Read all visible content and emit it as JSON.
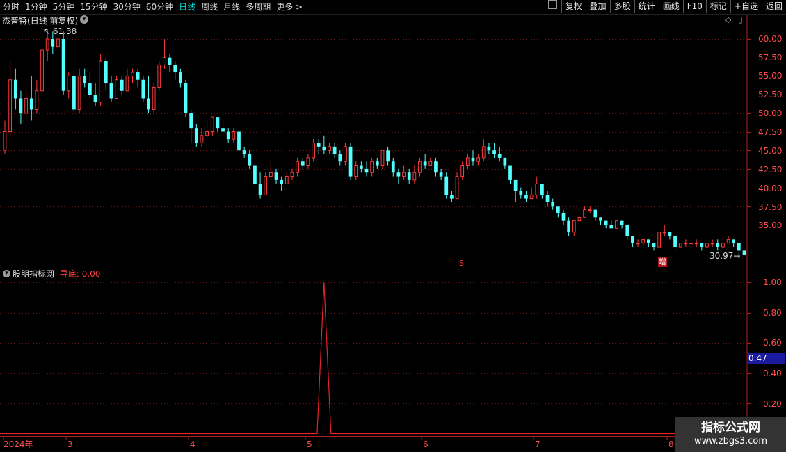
{
  "toolbar": {
    "periods": [
      "分时",
      "1分钟",
      "5分钟",
      "15分钟",
      "30分钟",
      "60分钟",
      "日线",
      "周线",
      "月线",
      "多周期",
      "更多 >"
    ],
    "active_period": "日线",
    "right_buttons": [
      "复权",
      "叠加",
      "多股",
      "统计",
      "画线",
      "F10",
      "标记",
      "+自选",
      "返回"
    ]
  },
  "main_chart": {
    "stock_name": "杰普特",
    "chart_desc": "(日线 前复权)",
    "high_label": "61.38",
    "low_label": "30.97",
    "marker_s": "S",
    "marker_zeng": "增",
    "y_ticks": [
      "60.00",
      "57.50",
      "55.00",
      "52.50",
      "50.00",
      "47.50",
      "45.00",
      "42.50",
      "40.00",
      "37.50",
      "35.00"
    ],
    "colors": {
      "up": "#ff3c3c",
      "down": "#54ffff",
      "grid": "#7a1414"
    }
  },
  "indicator": {
    "name": "股朋指标网",
    "line_label": "寻底:",
    "line_value": "0.00",
    "y_ticks": [
      "1.00",
      "0.80",
      "0.60",
      "0.40",
      "0.20"
    ],
    "current_value": "0.47"
  },
  "x_axis": {
    "labels": [
      "2024年",
      "3",
      "4",
      "5",
      "6",
      "7",
      "8"
    ]
  },
  "watermark": {
    "line1": "指标公式网",
    "line2": "www.zbgs3.com"
  },
  "chart_data": {
    "type": "candlestick",
    "title": "杰普特 (日线 前复权)",
    "ylim": [
      31,
      62
    ],
    "candles": [
      [
        45.0,
        47.5,
        44.5,
        49.0
      ],
      [
        47.5,
        54.5,
        47.0,
        57.0
      ],
      [
        54.5,
        52.0,
        50.5,
        56.0
      ],
      [
        52.0,
        50.0,
        48.5,
        53.0
      ],
      [
        50.0,
        52.0,
        49.0,
        54.0
      ],
      [
        52.0,
        50.5,
        49.0,
        55.0
      ],
      [
        50.5,
        53.0,
        50.0,
        54.5
      ],
      [
        53.0,
        58.5,
        52.5,
        59.0
      ],
      [
        58.5,
        60.0,
        57.0,
        61.38
      ],
      [
        60.0,
        59.0,
        58.0,
        61.0
      ],
      [
        59.0,
        60.0,
        58.5,
        60.5
      ],
      [
        60.0,
        53.0,
        52.5,
        61.0
      ],
      [
        53.0,
        55.0,
        52.0,
        55.5
      ],
      [
        55.0,
        50.5,
        50.0,
        55.5
      ],
      [
        50.5,
        55.0,
        50.0,
        56.0
      ],
      [
        55.0,
        54.0,
        53.5,
        56.0
      ],
      [
        54.0,
        52.5,
        52.0,
        55.5
      ],
      [
        52.5,
        51.5,
        51.0,
        54.0
      ],
      [
        51.5,
        57.0,
        51.0,
        58.0
      ],
      [
        57.0,
        54.0,
        53.0,
        57.5
      ],
      [
        54.0,
        52.0,
        51.5,
        55.0
      ],
      [
        52.0,
        54.5,
        52.0,
        55.0
      ],
      [
        54.5,
        53.0,
        52.5,
        55.0
      ],
      [
        53.0,
        55.0,
        53.0,
        56.0
      ],
      [
        55.0,
        55.5,
        54.0,
        56.0
      ],
      [
        55.5,
        54.5,
        53.5,
        56.0
      ],
      [
        54.5,
        52.0,
        51.5,
        55.0
      ],
      [
        52.0,
        50.5,
        50.0,
        55.0
      ],
      [
        50.5,
        53.5,
        50.0,
        54.0
      ],
      [
        53.5,
        56.5,
        53.0,
        57.0
      ],
      [
        56.5,
        57.5,
        56.0,
        60.0
      ],
      [
        57.5,
        56.5,
        55.5,
        58.0
      ],
      [
        56.5,
        55.5,
        54.5,
        57.0
      ],
      [
        55.5,
        54.0,
        53.5,
        56.0
      ],
      [
        54.0,
        50.0,
        49.5,
        54.5
      ],
      [
        50.0,
        48.0,
        46.0,
        50.5
      ],
      [
        48.0,
        46.0,
        45.5,
        48.5
      ],
      [
        46.0,
        47.0,
        45.5,
        48.0
      ],
      [
        47.0,
        47.5,
        46.5,
        49.0
      ],
      [
        47.5,
        49.5,
        47.0,
        49.5
      ],
      [
        49.5,
        48.0,
        47.5,
        49.5
      ],
      [
        48.0,
        47.5,
        47.0,
        49.0
      ],
      [
        47.5,
        46.5,
        46.0,
        48.0
      ],
      [
        46.5,
        47.5,
        46.0,
        48.0
      ],
      [
        47.5,
        45.0,
        44.5,
        48.0
      ],
      [
        45.0,
        44.5,
        44.0,
        45.5
      ],
      [
        44.5,
        43.0,
        42.5,
        45.0
      ],
      [
        43.0,
        40.5,
        40.0,
        43.5
      ],
      [
        40.5,
        39.0,
        38.5,
        42.0
      ],
      [
        39.0,
        41.5,
        39.0,
        42.0
      ],
      [
        41.5,
        42.0,
        41.0,
        43.5
      ],
      [
        42.0,
        41.0,
        40.5,
        42.5
      ],
      [
        41.0,
        40.5,
        39.5,
        41.5
      ],
      [
        40.5,
        41.5,
        40.5,
        42.0
      ],
      [
        41.5,
        42.0,
        41.0,
        42.5
      ],
      [
        42.0,
        43.5,
        41.5,
        44.0
      ],
      [
        43.5,
        43.0,
        42.5,
        44.0
      ],
      [
        43.0,
        44.0,
        42.5,
        44.5
      ],
      [
        44.0,
        46.0,
        43.5,
        46.5
      ],
      [
        46.0,
        45.5,
        44.5,
        46.5
      ],
      [
        45.5,
        45.0,
        44.5,
        47.0
      ],
      [
        45.0,
        45.5,
        44.5,
        46.0
      ],
      [
        45.5,
        44.5,
        44.0,
        46.0
      ],
      [
        44.5,
        43.5,
        43.0,
        45.0
      ],
      [
        43.5,
        45.5,
        43.0,
        46.0
      ],
      [
        45.5,
        41.5,
        41.0,
        46.0
      ],
      [
        41.5,
        43.0,
        41.0,
        43.5
      ],
      [
        43.0,
        42.5,
        42.0,
        43.5
      ],
      [
        42.5,
        42.0,
        41.5,
        43.5
      ],
      [
        42.0,
        43.5,
        41.5,
        44.0
      ],
      [
        43.5,
        43.0,
        42.5,
        44.0
      ],
      [
        43.0,
        45.0,
        42.5,
        45.0
      ],
      [
        45.0,
        43.5,
        43.0,
        45.5
      ],
      [
        43.5,
        42.0,
        41.5,
        44.0
      ],
      [
        42.0,
        41.5,
        40.5,
        42.5
      ],
      [
        41.5,
        42.0,
        41.0,
        43.0
      ],
      [
        42.0,
        41.0,
        40.5,
        42.5
      ],
      [
        41.0,
        42.0,
        40.5,
        43.0
      ],
      [
        42.0,
        43.5,
        41.5,
        44.0
      ],
      [
        43.5,
        43.0,
        42.5,
        44.5
      ],
      [
        43.0,
        43.5,
        43.0,
        44.0
      ],
      [
        43.5,
        42.0,
        41.5,
        44.0
      ],
      [
        42.0,
        41.5,
        41.0,
        42.5
      ],
      [
        41.5,
        39.0,
        38.5,
        42.0
      ],
      [
        39.0,
        38.5,
        38.0,
        39.5
      ],
      [
        38.5,
        41.5,
        38.5,
        42.0
      ],
      [
        41.5,
        43.0,
        41.0,
        43.5
      ],
      [
        43.0,
        44.0,
        42.5,
        44.5
      ],
      [
        44.0,
        43.5,
        43.0,
        45.0
      ],
      [
        43.5,
        44.0,
        43.0,
        44.5
      ],
      [
        44.0,
        45.5,
        43.5,
        46.5
      ],
      [
        45.5,
        45.0,
        44.5,
        46.0
      ],
      [
        45.0,
        44.5,
        44.0,
        46.0
      ],
      [
        44.5,
        44.0,
        43.5,
        45.5
      ],
      [
        44.0,
        43.0,
        42.5,
        44.0
      ],
      [
        43.0,
        41.0,
        40.5,
        43.0
      ],
      [
        41.0,
        39.5,
        38.0,
        41.0
      ],
      [
        39.5,
        39.0,
        38.5,
        40.0
      ],
      [
        39.0,
        38.5,
        38.0,
        39.5
      ],
      [
        38.5,
        39.0,
        38.5,
        40.0
      ],
      [
        39.0,
        40.5,
        38.5,
        41.5
      ],
      [
        40.5,
        39.0,
        38.5,
        40.5
      ],
      [
        39.0,
        38.0,
        37.5,
        39.5
      ],
      [
        38.0,
        37.5,
        37.0,
        38.5
      ],
      [
        37.5,
        36.5,
        36.0,
        37.5
      ],
      [
        36.5,
        35.5,
        35.0,
        37.0
      ],
      [
        35.5,
        34.0,
        33.5,
        36.0
      ],
      [
        34.0,
        35.5,
        33.5,
        35.5
      ],
      [
        35.5,
        36.0,
        35.5,
        36.0
      ],
      [
        36.0,
        37.0,
        36.0,
        37.5
      ],
      [
        37.0,
        37.0,
        36.5,
        37.5
      ],
      [
        37.0,
        36.0,
        35.5,
        37.0
      ],
      [
        36.0,
        35.5,
        35.0,
        36.0
      ],
      [
        35.5,
        35.0,
        34.5,
        35.5
      ],
      [
        35.0,
        34.5,
        34.5,
        35.5
      ],
      [
        34.5,
        35.5,
        34.5,
        35.5
      ],
      [
        35.5,
        35.0,
        34.5,
        35.5
      ],
      [
        35.0,
        33.5,
        33.0,
        35.0
      ],
      [
        33.5,
        32.5,
        32.0,
        33.5
      ],
      [
        32.5,
        32.5,
        32.0,
        33.0
      ],
      [
        32.5,
        33.0,
        32.0,
        33.0
      ],
      [
        33.0,
        32.5,
        32.0,
        33.0
      ],
      [
        32.5,
        32.0,
        31.5,
        32.5
      ],
      [
        32.0,
        34.0,
        32.0,
        34.0
      ],
      [
        34.0,
        34.0,
        33.5,
        35.0
      ],
      [
        34.0,
        33.5,
        33.0,
        34.0
      ],
      [
        33.5,
        32.0,
        31.5,
        33.5
      ],
      [
        32.0,
        32.5,
        32.0,
        32.5
      ],
      [
        32.5,
        32.5,
        32.0,
        33.0
      ],
      [
        32.5,
        32.5,
        32.0,
        33.0
      ],
      [
        32.5,
        32.5,
        32.0,
        33.0
      ],
      [
        32.5,
        32.0,
        31.5,
        32.5
      ],
      [
        32.0,
        32.5,
        32.0,
        32.5
      ],
      [
        32.5,
        32.5,
        32.0,
        33.0
      ],
      [
        32.5,
        32.0,
        31.5,
        33.0
      ],
      [
        32.0,
        32.5,
        32.0,
        33.5
      ],
      [
        32.5,
        33.0,
        32.5,
        33.5
      ],
      [
        33.0,
        32.5,
        32.0,
        33.0
      ],
      [
        32.5,
        31.5,
        31.0,
        32.5
      ],
      [
        31.5,
        30.97,
        30.97,
        31.5
      ]
    ],
    "indicator": {
      "name": "寻底",
      "ylim": [
        0.1,
        1.1
      ],
      "spike_index": 60,
      "spike_value": 1.0,
      "baseline": 0.0
    }
  }
}
